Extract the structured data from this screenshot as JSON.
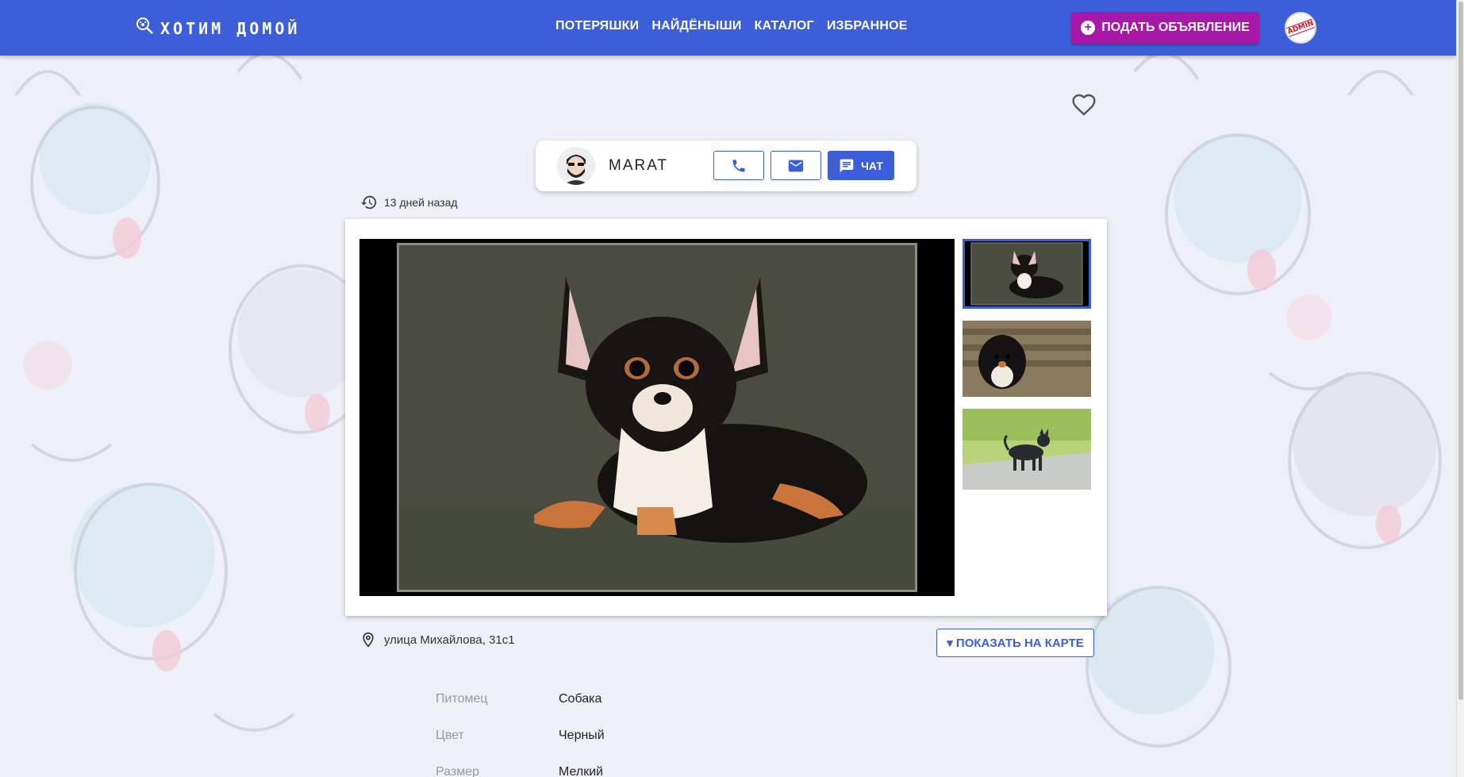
{
  "header": {
    "logo_text": "ХОТИМ ДОМОЙ",
    "nav": [
      "ПОТЕРЯШКИ",
      "НАЙДЁНЫШИ",
      "КАТАЛОГ",
      "ИЗБРАННОЕ"
    ],
    "post_button": "ПОДАТЬ ОБЪЯВЛЕНИЕ",
    "avatar_text": "ADMIN",
    "colors": {
      "bar": "#3c5fd9",
      "post_button": "#a718a9"
    }
  },
  "favorite": {
    "icon": "heart-outline-icon"
  },
  "user": {
    "name": "MARAT",
    "phone_icon": "phone-icon",
    "email_icon": "mail-icon",
    "chat_label": "ЧАТ"
  },
  "posted": {
    "icon": "history-icon",
    "text": "13 дней назад"
  },
  "gallery": {
    "main_alt": "chihuahua-photo",
    "thumbs": [
      "chihuahua-lying",
      "long-haired-chihuahua",
      "chihuahua-standing"
    ],
    "selected_index": 0
  },
  "location": {
    "icon": "map-pin-icon",
    "address": "улица Михайлова, 31с1",
    "map_button": "▾ ПОКАЗАТЬ НА КАРТЕ"
  },
  "properties": [
    {
      "key": "Питомец",
      "value": "Собака"
    },
    {
      "key": "Цвет",
      "value": "Черный"
    },
    {
      "key": "Размер",
      "value": "Мелкий"
    }
  ]
}
